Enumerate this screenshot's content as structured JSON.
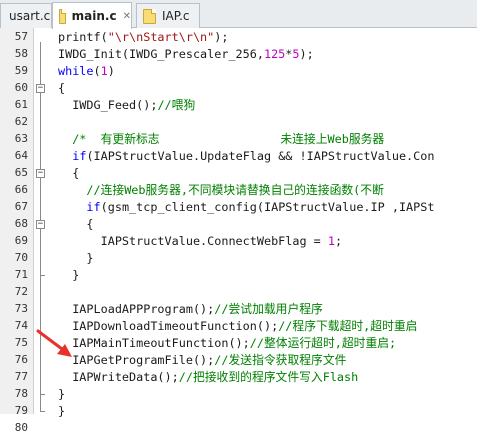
{
  "tabs": [
    {
      "label": "usart.c",
      "active": false
    },
    {
      "label": "main.c",
      "active": true
    },
    {
      "label": "IAP.c",
      "active": false
    }
  ],
  "code_lines": [
    {
      "n": "57",
      "segs": [
        [
          "t",
          "printf("
        ],
        [
          "s",
          "\"\\r\\nStart\\r\\n\""
        ],
        [
          "t",
          ");"
        ]
      ]
    },
    {
      "n": "58",
      "segs": [
        [
          "t",
          "IWDG_Init(IWDG_Prescaler_256,"
        ],
        [
          "n",
          "125"
        ],
        [
          "t",
          "*"
        ],
        [
          "n",
          "5"
        ],
        [
          "t",
          ");"
        ]
      ]
    },
    {
      "n": "59",
      "segs": [
        [
          "k",
          "while"
        ],
        [
          "t",
          "("
        ],
        [
          "n",
          "1"
        ],
        [
          "t",
          ")"
        ]
      ]
    },
    {
      "n": "60",
      "segs": [
        [
          "t",
          "{"
        ]
      ]
    },
    {
      "n": "61",
      "segs": [
        [
          "t",
          "  IWDG_Feed();"
        ],
        [
          "c",
          "//喂狗"
        ]
      ]
    },
    {
      "n": "62",
      "segs": [
        [
          "t",
          ""
        ]
      ]
    },
    {
      "n": "63",
      "segs": [
        [
          "c",
          "  /*  有更新标志                 未连接上Web服务器"
        ]
      ]
    },
    {
      "n": "64",
      "segs": [
        [
          "t",
          "  "
        ],
        [
          "k",
          "if"
        ],
        [
          "t",
          "(IAPStructValue.UpdateFlag && !IAPStructValue.Con"
        ]
      ]
    },
    {
      "n": "65",
      "segs": [
        [
          "t",
          "  {"
        ]
      ]
    },
    {
      "n": "66",
      "segs": [
        [
          "c",
          "    //连接Web服务器,不同模块请替换自己的连接函数(不断"
        ]
      ]
    },
    {
      "n": "67",
      "segs": [
        [
          "t",
          "    "
        ],
        [
          "k",
          "if"
        ],
        [
          "t",
          "(gsm_tcp_client_config(IAPStructValue.IP ,IAPSt"
        ]
      ]
    },
    {
      "n": "68",
      "segs": [
        [
          "t",
          "    {"
        ]
      ]
    },
    {
      "n": "69",
      "segs": [
        [
          "t",
          "      IAPStructValue.ConnectWebFlag = "
        ],
        [
          "n",
          "1"
        ],
        [
          "t",
          ";"
        ]
      ]
    },
    {
      "n": "70",
      "segs": [
        [
          "t",
          "    }"
        ]
      ]
    },
    {
      "n": "71",
      "segs": [
        [
          "t",
          "  }"
        ]
      ]
    },
    {
      "n": "72",
      "segs": [
        [
          "t",
          ""
        ]
      ]
    },
    {
      "n": "73",
      "segs": [
        [
          "t",
          "  IAPLoadAPPProgram();"
        ],
        [
          "c",
          "//尝试加载用户程序"
        ]
      ]
    },
    {
      "n": "74",
      "segs": [
        [
          "t",
          "  IAPDownloadTimeoutFunction();"
        ],
        [
          "c",
          "//程序下载超时,超时重启"
        ]
      ]
    },
    {
      "n": "75",
      "segs": [
        [
          "t",
          "  IAPMainTimeoutFunction();"
        ],
        [
          "c",
          "//整体运行超时,超时重启;"
        ]
      ]
    },
    {
      "n": "76",
      "segs": [
        [
          "t",
          "  IAPGetProgramFile();"
        ],
        [
          "c",
          "//发送指令获取程序文件"
        ]
      ]
    },
    {
      "n": "77",
      "segs": [
        [
          "t",
          "  IAPWriteData();"
        ],
        [
          "c",
          "//把接收到的程序文件写入Flash"
        ]
      ]
    },
    {
      "n": "78",
      "segs": [
        [
          "t",
          "}"
        ]
      ]
    },
    {
      "n": "79",
      "segs": [
        [
          "t",
          "}"
        ]
      ]
    },
    {
      "n": "80",
      "segs": [
        [
          "t",
          ""
        ]
      ]
    }
  ],
  "colors": {
    "keyword": "#0000ff",
    "string": "#a31515",
    "comment": "#008000",
    "number": "#c000c0",
    "arrow": "#e8312a"
  },
  "annotation": {
    "type": "arrow",
    "points_to_line": "77",
    "color_name": "red"
  }
}
